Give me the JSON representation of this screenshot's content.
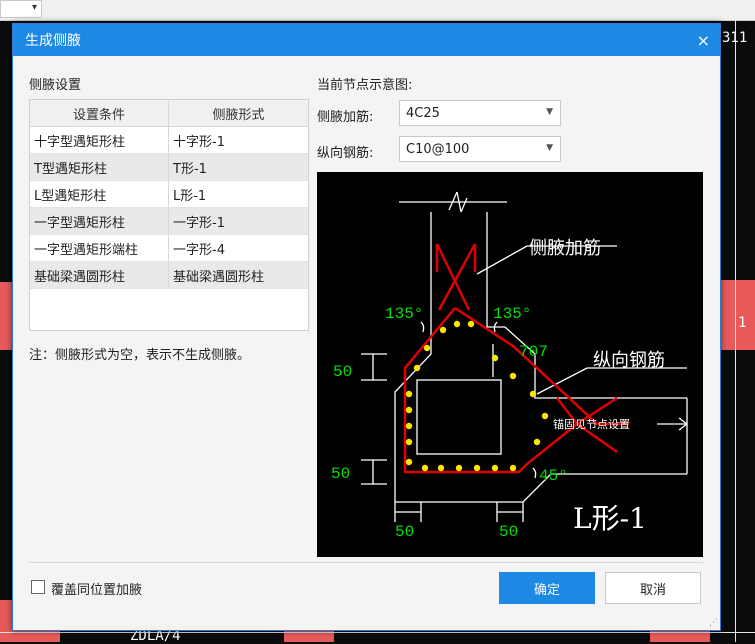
{
  "background": {
    "corner_text": "311",
    "right_text": "1",
    "bottom_text": "ZDLA/4"
  },
  "dialog": {
    "title": "生成侧腋",
    "close_label": "×",
    "left": {
      "heading": "侧腋设置",
      "table": {
        "headers": [
          "设置条件",
          "侧腋形式"
        ],
        "rows": [
          [
            "十字型遇矩形柱",
            "十字形-1"
          ],
          [
            "T型遇矩形柱",
            "T形-1"
          ],
          [
            "L型遇矩形柱",
            "L形-1"
          ],
          [
            "一字型遇矩形柱",
            "一字形-1"
          ],
          [
            "一字型遇矩形端柱",
            "一字形-4"
          ],
          [
            "基础梁遇圆形柱",
            "基础梁遇圆形柱"
          ]
        ]
      },
      "note": "注：侧腋形式为空，表示不生成侧腋。"
    },
    "right": {
      "heading": "当前节点示意图:",
      "side_rebar_label": "侧腋加筋:",
      "side_rebar_value": "4C25",
      "long_rebar_label": "纵向钢筋:",
      "long_rebar_value": "C10@100"
    },
    "diagram": {
      "label_side_rebar": "侧腋加筋",
      "label_long_rebar": "纵向钢筋",
      "label_anchor": "锚固见节点设置",
      "angle_left": "135°",
      "angle_right": "135°",
      "angle_bottom": "45°",
      "dim_707": "707",
      "dim_50_left_top": "50",
      "dim_50_left_bottom": "50",
      "dim_50_bottom_left": "50",
      "dim_50_bottom_right": "50",
      "shape_name": "L形-1"
    },
    "footer": {
      "override_label": "覆盖同位置加腋",
      "ok_label": "确定",
      "cancel_label": "取消"
    }
  }
}
